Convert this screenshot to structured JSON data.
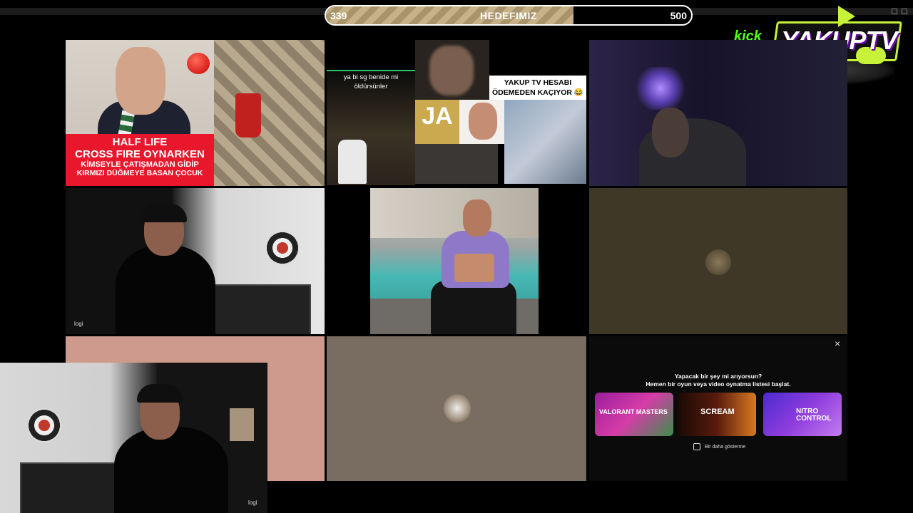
{
  "goal_bar": {
    "current": "339",
    "title": "HEDEFIMIZ",
    "max": "500",
    "progress": 0.678
  },
  "logo": {
    "kick": "kick",
    "brand": "YAKUPTV"
  },
  "tiles": {
    "meme1": {
      "line1": "HALF LIFE",
      "line2": "CROSS FIRE OYNARKEN",
      "line3": "KİMSEYLE ÇATIŞMADAN GİDİP",
      "line4": "KIRMIZI DÜĞMEYE BASAN ÇOCUK"
    },
    "collage": {
      "text": "ya bi sg benide mi öldürsünler",
      "caption": "YAKUP TV HESABI ÖDEMEDEN KAÇIYOR 😂",
      "ja": "JA"
    },
    "webcam2": {
      "label": "logi"
    },
    "promo": {
      "title": "Yapacak bir şey mi arıyorsun?",
      "subtitle": "Hemen bir oyun veya video oynatma listesi başlat.",
      "cards": [
        "VALORANT MASTERS",
        "SCREAM",
        "NITRO CONTROL"
      ],
      "checkbox_label": "Bir daha gösterme",
      "close": "×"
    }
  },
  "overlay": {
    "label": "logi"
  }
}
